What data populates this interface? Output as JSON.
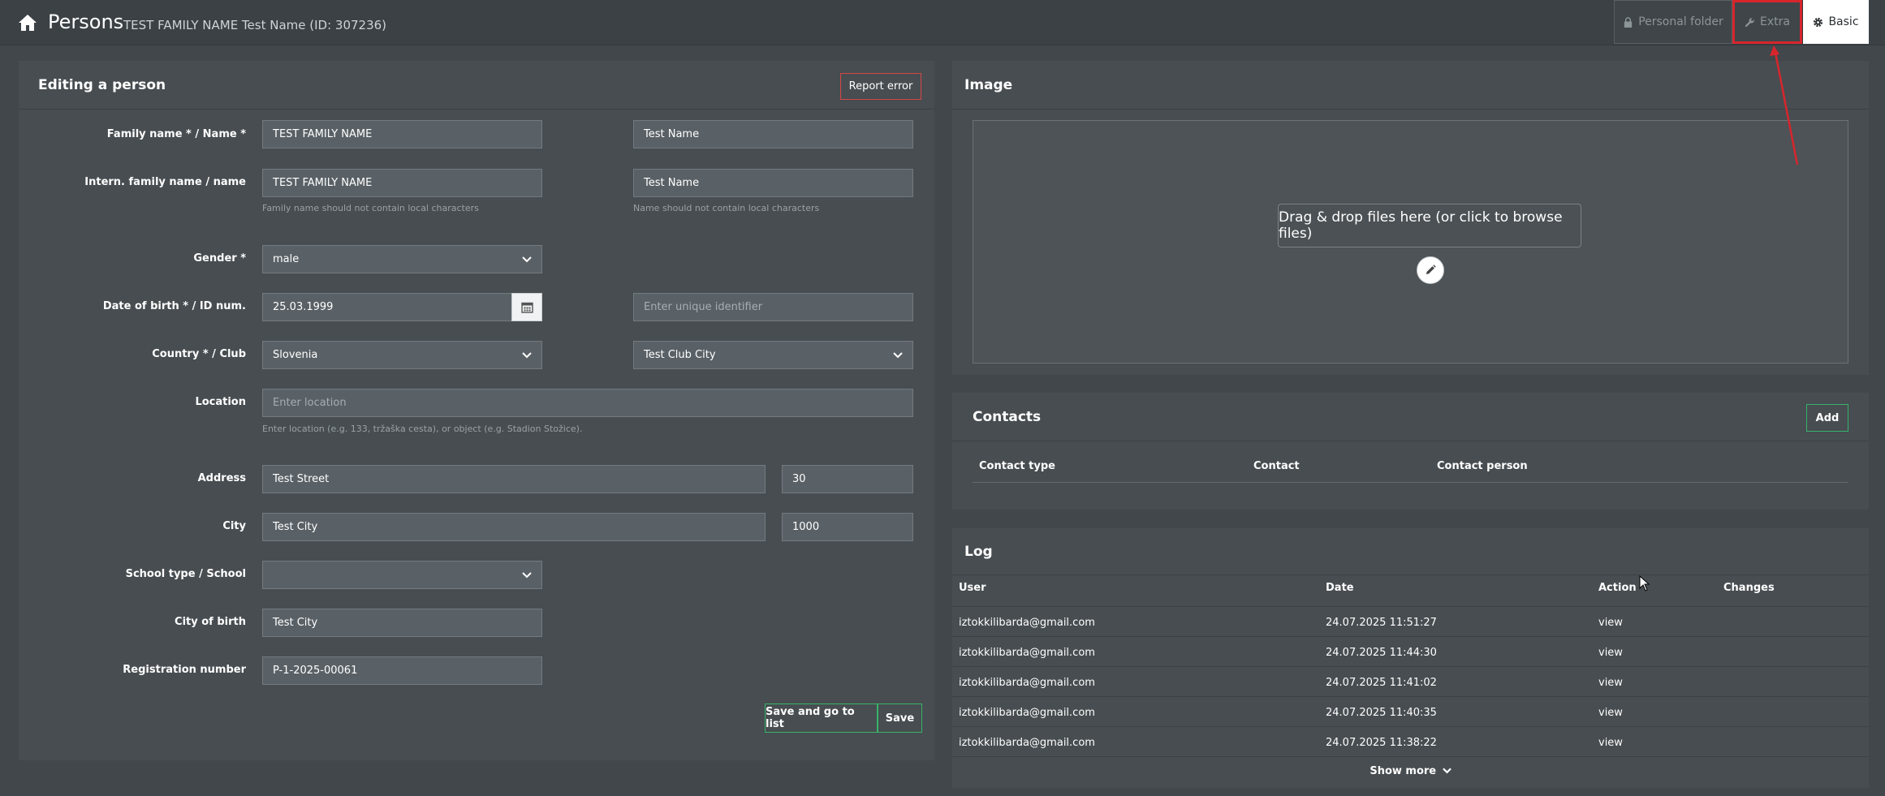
{
  "header": {
    "title": "Persons",
    "subtitle": "TEST FAMILY NAME Test Name (ID: 307236)",
    "tabs": {
      "personal_folder": "Personal folder",
      "extra": "Extra",
      "basic": "Basic"
    },
    "highlight_color": "#d6262c"
  },
  "form": {
    "title": "Editing a person",
    "report_error": "Report error",
    "fields": {
      "family_name_label": "Family name * / Name *",
      "family_name_value": "TEST FAMILY NAME",
      "name_value": "Test Name",
      "intern_label": "Intern. family name / name",
      "intern_family_value": "TEST FAMILY NAME",
      "intern_name_value": "Test Name",
      "intern_family_hint": "Family name should not contain local characters",
      "intern_name_hint": "Name should not contain local characters",
      "gender_label": "Gender *",
      "gender_value": "male",
      "dob_label": "Date of birth * / ID num.",
      "dob_value": "25.03.1999",
      "id_placeholder": "Enter unique identifier",
      "country_label": "Country * / Club",
      "country_value": "Slovenia",
      "club_value": "Test Club City",
      "location_label": "Location",
      "location_placeholder": "Enter location",
      "location_hint": "Enter location (e.g. 133, tržaška cesta), or object (e.g. Stadion Stožice).",
      "address_label": "Address",
      "address_value": "Test Street",
      "house_number_value": "30",
      "city_label": "City",
      "city_value": "Test City",
      "postal_value": "1000",
      "school_label": "School type / School",
      "school_value": "",
      "city_of_birth_label": "City of birth",
      "city_of_birth_value": "Test City",
      "registration_label": "Registration number",
      "registration_value": "P-1-2025-00061"
    },
    "save_and_list": "Save and go to list",
    "save": "Save"
  },
  "image_panel": {
    "title": "Image",
    "drop_message": "Drag & drop files here (or click to browse files)"
  },
  "contacts": {
    "title": "Contacts",
    "add": "Add",
    "columns": [
      "Contact type",
      "Contact",
      "Contact person"
    ]
  },
  "log": {
    "title": "Log",
    "columns": [
      "User",
      "Date",
      "Action",
      "Changes"
    ],
    "rows": [
      {
        "user": "iztokkilibarda@gmail.com",
        "date": "24.07.2025 11:51:27",
        "action": "view",
        "changes": ""
      },
      {
        "user": "iztokkilibarda@gmail.com",
        "date": "24.07.2025 11:44:30",
        "action": "view",
        "changes": ""
      },
      {
        "user": "iztokkilibarda@gmail.com",
        "date": "24.07.2025 11:41:02",
        "action": "view",
        "changes": ""
      },
      {
        "user": "iztokkilibarda@gmail.com",
        "date": "24.07.2025 11:40:35",
        "action": "view",
        "changes": ""
      },
      {
        "user": "iztokkilibarda@gmail.com",
        "date": "24.07.2025 11:38:22",
        "action": "view",
        "changes": ""
      }
    ],
    "show_more": "Show more"
  }
}
